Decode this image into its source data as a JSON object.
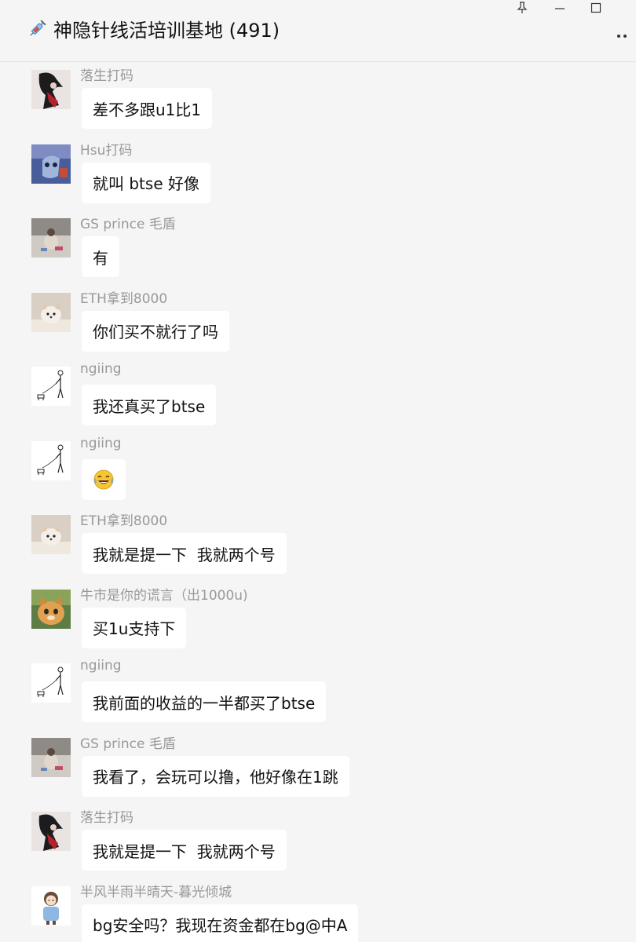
{
  "window": {
    "title": "神隐针线活培训基地 (491)",
    "controls": {
      "pin_icon": "pin-icon",
      "minimize_icon": "minimize-icon",
      "maximize_icon": "maximize-icon",
      "more_icon": "more-icon"
    }
  },
  "colors": {
    "background": "#f5f5f5",
    "bubble": "#ffffff",
    "sender_text": "#999999",
    "message_text": "#111111"
  },
  "messages": [
    {
      "sender": "落生打码",
      "text": "差不多跟u1比1",
      "avatar": "avatar-dark-figure"
    },
    {
      "sender": "Hsu打码",
      "text": "就叫 btse 好像",
      "avatar": "avatar-blue-cartoon"
    },
    {
      "sender": "GS prince 毛盾",
      "text": "有",
      "avatar": "avatar-sitting-person"
    },
    {
      "sender": "ETH拿到8000",
      "text": "你们买不就行了吗",
      "avatar": "avatar-white-dog"
    },
    {
      "sender": "ngiing",
      "text": "我还真买了btse",
      "avatar": "avatar-stick-figure-dog"
    },
    {
      "sender": "ngiing",
      "text": "",
      "emoji": "laughing-tears-emoji",
      "avatar": "avatar-stick-figure-dog"
    },
    {
      "sender": "ETH拿到8000",
      "text": "我就是提一下  我就两个号",
      "avatar": "avatar-white-dog"
    },
    {
      "sender": "牛市是你的谎言（出1000u)",
      "text": "买1u支持下",
      "avatar": "avatar-orange-cat"
    },
    {
      "sender": "ngiing",
      "text": "我前面的收益的一半都买了btse",
      "avatar": "avatar-stick-figure-dog"
    },
    {
      "sender": "GS prince 毛盾",
      "text": "我看了，会玩可以撸，他好像在1跳",
      "avatar": "avatar-sitting-person"
    },
    {
      "sender": "落生打码",
      "text": "我就是提一下  我就两个号",
      "avatar": "avatar-dark-figure"
    },
    {
      "sender": "半风半雨半晴天-暮光倾城",
      "text": "bg安全吗？我现在资金都在bg@中A",
      "avatar": "avatar-cartoon-girl"
    }
  ]
}
